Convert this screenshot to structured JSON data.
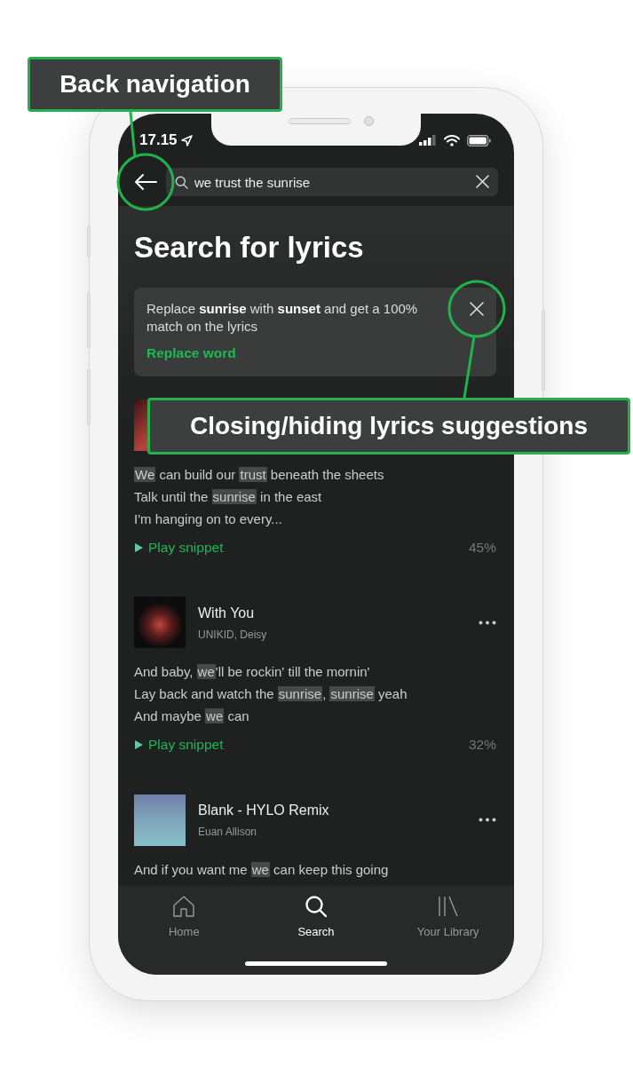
{
  "status_bar": {
    "time": "17.15"
  },
  "search": {
    "value": "we trust the sunrise"
  },
  "heading": "Search for lyrics",
  "suggestion": {
    "message": "Replace **sunrise** with **sunset** and get a 100% match on the lyrics",
    "action": "Replace word"
  },
  "tracks": [
    {
      "lyrics": [
        [
          {
            "text": "We",
            "match": true
          },
          {
            "text": " can build our ",
            "match": false
          },
          {
            "text": "trust",
            "match": true
          },
          {
            "text": " beneath the sheets",
            "match": false
          }
        ],
        [
          {
            "text": "Talk until the ",
            "match": false
          },
          {
            "text": "sunrise",
            "match": true
          },
          {
            "text": " in the east",
            "match": false
          }
        ],
        [
          {
            "text": "I'm hanging on to every...",
            "match": false
          }
        ]
      ],
      "snippet": "Play snippet",
      "match_percent": "45%"
    },
    {
      "title": "With You",
      "artist": "UNIKID, Deisy",
      "lyrics": [
        [
          {
            "text": "And baby, ",
            "match": false
          },
          {
            "text": "we",
            "match": true
          },
          {
            "text": "'ll be rockin' till the mornin'",
            "match": false
          }
        ],
        [
          {
            "text": "Lay back and watch the ",
            "match": false
          },
          {
            "text": "sunrise",
            "match": true
          },
          {
            "text": ", ",
            "match": false
          },
          {
            "text": "sunrise",
            "match": true
          },
          {
            "text": " yeah",
            "match": false
          }
        ],
        [
          {
            "text": "And maybe ",
            "match": false
          },
          {
            "text": "we",
            "match": true
          },
          {
            "text": " can",
            "match": false
          }
        ]
      ],
      "snippet": "Play snippet",
      "match_percent": "32%"
    },
    {
      "title": "Blank - HYLO Remix",
      "artist": "Euan Allison",
      "lyrics": [
        [
          {
            "text": "And if you want me ",
            "match": false
          },
          {
            "text": "we",
            "match": true
          },
          {
            "text": " can keep this going",
            "match": false
          }
        ]
      ]
    }
  ],
  "tab_bar": [
    {
      "kind": "home",
      "label": "Home",
      "selected": false
    },
    {
      "kind": "search",
      "label": "Search",
      "selected": true
    },
    {
      "kind": "library",
      "label": "Your Library",
      "selected": false
    }
  ],
  "annotations": [
    {
      "kind": "back",
      "label": "Back navigation"
    },
    {
      "kind": "close",
      "label": "Closing/hiding lyrics suggestions"
    }
  ]
}
